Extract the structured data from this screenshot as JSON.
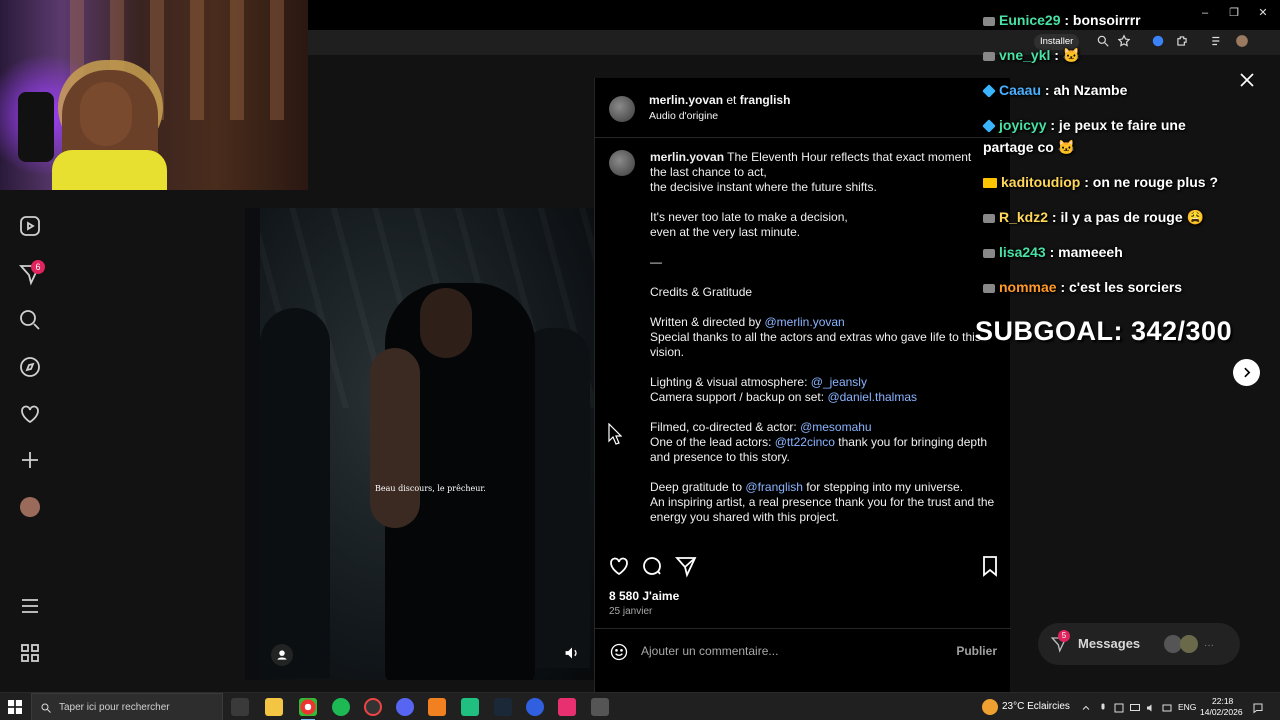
{
  "post": {
    "author_primary": "merlin.yovan",
    "coauthor_connector": "et",
    "author_secondary": "franglish",
    "audio": "Audio d'origine",
    "caption_lines": [
      {
        "user": "merlin.yovan",
        "text": " The Eleventh Hour reflects that exact moment"
      },
      {
        "text": "the last chance to act,"
      },
      {
        "text": "the decisive instant where the future shifts."
      },
      {
        "text": ""
      },
      {
        "text": "It's never too late to make a decision,"
      },
      {
        "text": "even at the very last minute."
      },
      {
        "text": ""
      },
      {
        "text": "—"
      },
      {
        "text": ""
      },
      {
        "text": "Credits & Gratitude"
      },
      {
        "text": ""
      },
      {
        "text": "Written & directed by ",
        "mention": "@merlin.yovan"
      },
      {
        "text": "Special thanks to all the actors and extras who gave life to this"
      },
      {
        "text": "vision."
      },
      {
        "text": ""
      },
      {
        "text": "Lighting & visual atmosphere: ",
        "mention": "@_jeansly"
      },
      {
        "text": "Camera support / backup on set: ",
        "mention": "@daniel.thalmas"
      },
      {
        "text": ""
      },
      {
        "text": "Filmed, co-directed & actor: ",
        "mention": "@mesomahu"
      },
      {
        "text": "One of the lead actors: ",
        "mention": "@tt22cinco",
        "after": " thank you for bringing depth"
      },
      {
        "text": "and presence to this story."
      },
      {
        "text": ""
      },
      {
        "text": "Deep gratitude to ",
        "mention": "@franglish",
        "after": " for stepping into my universe."
      },
      {
        "text": "An inspiring artist, a real presence thank you for the trust and the"
      },
      {
        "text": "energy you shared with this project."
      }
    ],
    "likes": "8 580 J'aime",
    "date": "25 janvier",
    "comment_placeholder": "Ajouter un commentaire...",
    "publish_label": "Publier"
  },
  "video": {
    "subtitle": "Beau discours, le prêcheur."
  },
  "nav": {
    "notification_count": "6"
  },
  "chat": {
    "messages": [
      {
        "user": "Eunice29",
        "text": " : bonsoirrrr",
        "color": "#49e1a4"
      },
      {
        "user": "vne_ykl",
        "text": " : ",
        "emote": "🐱",
        "color": "#49e1a4"
      },
      {
        "user": "Caaau",
        "text": " : ah Nzambe",
        "color": "#4ab0ff"
      },
      {
        "user": "joyicyy",
        "text": " : je peux te faire une",
        "color": "#49e1a4"
      },
      {
        "user": "",
        "text": "partage co ",
        "emote": "🐱",
        "color": "#49e1a4"
      },
      {
        "user": "kaditoudiop",
        "text": " : on ne rouge plus ?",
        "color": "#ffd85a"
      },
      {
        "user": "R_kdz2",
        "text": " : il y a pas de rouge ",
        "emote": "😩",
        "color": "#ffd85a"
      },
      {
        "user": "lisa243",
        "text": " : mameeeh",
        "color": "#49e1a4"
      },
      {
        "user": "nommae",
        "text": " : c'est les sorciers",
        "color": "#ff9a2a"
      }
    ],
    "subgoal": "SUBGOAL: 342/300"
  },
  "browser": {
    "install_label": "Installer"
  },
  "messages_widget": {
    "label": "Messages",
    "badge": "5"
  },
  "taskbar": {
    "search_placeholder": "Taper ici pour rechercher",
    "weather": "23°C  Eclaircies",
    "language": "ENG",
    "time": "22:18",
    "date": "14/02/2026"
  },
  "colors": {
    "mention": "#8ab4ff",
    "notification": "#e0245e",
    "chat_green": "#49e1a4"
  }
}
